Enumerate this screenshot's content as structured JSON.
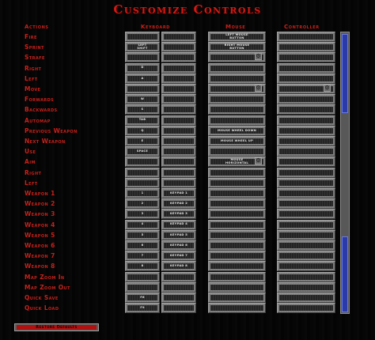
{
  "window": {
    "title": "Customize Controls"
  },
  "columns": {
    "actions": "Actions",
    "keyboard": "Keyboard",
    "mouse": "Mouse",
    "controller": "Controller"
  },
  "rows": [
    {
      "action": "Fire",
      "key1": "",
      "key2": "",
      "mouse": "LEFT MOUSE\nBUTTON",
      "controller": ""
    },
    {
      "action": "Sprint",
      "key1": "LEFT\nSHIFT",
      "key2": "",
      "mouse": "RIGHT MOUSE\nBUTTON",
      "controller": ""
    },
    {
      "action": "Strafe",
      "key1": "",
      "key2": "",
      "mouse": "",
      "controller": ""
    },
    {
      "action": "Right",
      "key1": "D",
      "key2": "",
      "mouse": "",
      "controller": ""
    },
    {
      "action": "Left",
      "key1": "A",
      "key2": "",
      "mouse": "",
      "controller": ""
    },
    {
      "action": "Move",
      "key1": "",
      "key2": "",
      "mouse": "",
      "controller": ""
    },
    {
      "action": "Forwards",
      "key1": "W",
      "key2": "",
      "mouse": "",
      "controller": ""
    },
    {
      "action": "Backwards",
      "key1": "S",
      "key2": "",
      "mouse": "",
      "controller": ""
    },
    {
      "action": "Automap",
      "key1": "TAB",
      "key2": "",
      "mouse": "",
      "controller": ""
    },
    {
      "action": "Previous Weapon",
      "key1": "Q",
      "key2": "",
      "mouse": "MOUSE WHEEL DOWN",
      "controller": ""
    },
    {
      "action": "Next Weapon",
      "key1": "E",
      "key2": "",
      "mouse": "MOUSE WHEEL UP",
      "controller": ""
    },
    {
      "action": "Use",
      "key1": "SPACE",
      "key2": "",
      "mouse": "",
      "controller": ""
    },
    {
      "action": "Aim",
      "key1": "",
      "key2": "",
      "mouse": "MOUSE\nHORIZONTAL",
      "controller": ""
    },
    {
      "action": "Right",
      "key1": "",
      "key2": "",
      "mouse": "",
      "controller": ""
    },
    {
      "action": "Left",
      "key1": "",
      "key2": "",
      "mouse": "",
      "controller": ""
    },
    {
      "action": "Weapon 1",
      "key1": "1",
      "key2": "KEYPAD 1",
      "mouse": "",
      "controller": ""
    },
    {
      "action": "Weapon 2",
      "key1": "2",
      "key2": "KEYPAD 2",
      "mouse": "",
      "controller": ""
    },
    {
      "action": "Weapon 3",
      "key1": "3",
      "key2": "KEYPAD 3",
      "mouse": "",
      "controller": ""
    },
    {
      "action": "Weapon 4",
      "key1": "4",
      "key2": "KEYPAD 4",
      "mouse": "",
      "controller": ""
    },
    {
      "action": "Weapon 5",
      "key1": "5",
      "key2": "KEYPAD 5",
      "mouse": "",
      "controller": ""
    },
    {
      "action": "Weapon 6",
      "key1": "6",
      "key2": "KEYPAD 6",
      "mouse": "",
      "controller": ""
    },
    {
      "action": "Weapon 7",
      "key1": "7",
      "key2": "KEYPAD 7",
      "mouse": "",
      "controller": ""
    },
    {
      "action": "Weapon 8",
      "key1": "8",
      "key2": "KEYPAD 8",
      "mouse": "",
      "controller": ""
    },
    {
      "action": "Map Zoom In",
      "key1": "",
      "key2": "",
      "mouse": "",
      "controller": ""
    },
    {
      "action": "Map Zoom Out",
      "key1": "",
      "key2": "",
      "mouse": "",
      "controller": ""
    },
    {
      "action": "Quick Save",
      "key1": "F6",
      "key2": "",
      "mouse": "",
      "controller": ""
    },
    {
      "action": "Quick Load",
      "key1": "F9",
      "key2": "",
      "mouse": "",
      "controller": ""
    }
  ],
  "reset_button": {
    "label": "Restore Defaults"
  },
  "icons": {
    "settings_glyph": "gear-icon",
    "scroll_up": "arrow-up-icon",
    "scroll_down": "arrow-down-icon"
  },
  "colors": {
    "accent": "#c8201a",
    "scroll_thumb": "#2a3aa8"
  }
}
